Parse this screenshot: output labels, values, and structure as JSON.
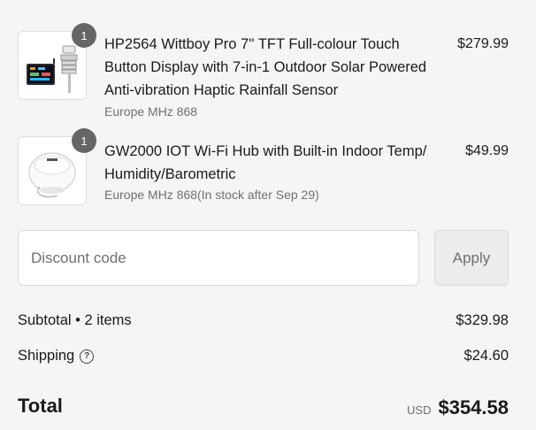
{
  "items": [
    {
      "quantity": "1",
      "title": "HP2564 Wittboy Pro 7'' TFT Full-colour Touch Button Display with 7-in-1 Outdoor Solar Powered Anti-vibration Haptic Rainfall Sensor",
      "variant": "Europe MHz 868",
      "price": "$279.99",
      "thumbnail_icon": "weather-station-display-icon"
    },
    {
      "quantity": "1",
      "title": "GW2000 IOT Wi-Fi Hub with Built-in Indoor Temp/ Humidity/Barometric",
      "variant": "Europe MHz 868(In stock after Sep 29)",
      "price": "$49.99",
      "thumbnail_icon": "wifi-hub-icon"
    }
  ],
  "discount": {
    "placeholder": "Discount code",
    "apply_label": "Apply"
  },
  "summary": {
    "subtotal_label": "Subtotal • 2 items",
    "subtotal_value": "$329.98",
    "shipping_label": "Shipping",
    "shipping_value": "$24.60",
    "total_label": "Total",
    "currency": "USD",
    "total_value": "$354.58"
  },
  "colors": {
    "background": "#f5f5f5",
    "badge": "#666666",
    "muted_text": "#707070",
    "border": "#d9d9d9"
  }
}
